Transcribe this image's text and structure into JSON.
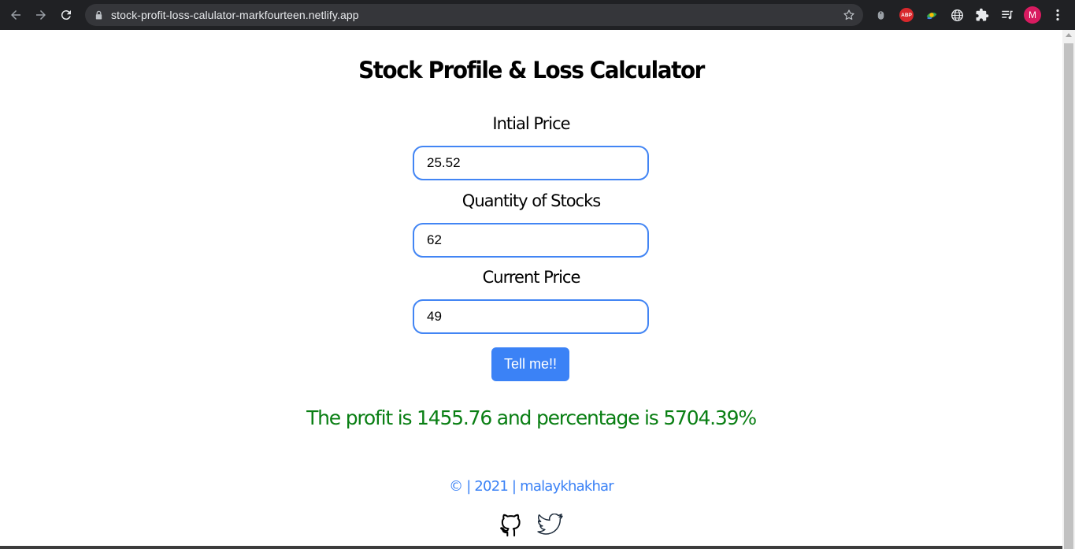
{
  "browser": {
    "url": "stock-profit-loss-calulator-markfourteen.netlify.app",
    "profile_initial": "M",
    "abp_label": "ABP"
  },
  "page": {
    "title": "Stock Profile & Loss Calculator",
    "initial_price_label": "Intial Price",
    "initial_price_value": "25.52",
    "quantity_label": "Quantity of Stocks",
    "quantity_value": "62",
    "current_price_label": "Current Price",
    "current_price_value": "49",
    "button_label": "Tell me!!",
    "result_text": "The profit is 1455.76 and percentage is 5704.39%",
    "footer_text": "© | 2021 | malaykhakhar"
  },
  "colors": {
    "accent": "#3b82f6",
    "input_border": "#4285f4",
    "result": "#0a7f14"
  },
  "icons": {
    "social": [
      "github-icon",
      "twitter-icon"
    ]
  }
}
